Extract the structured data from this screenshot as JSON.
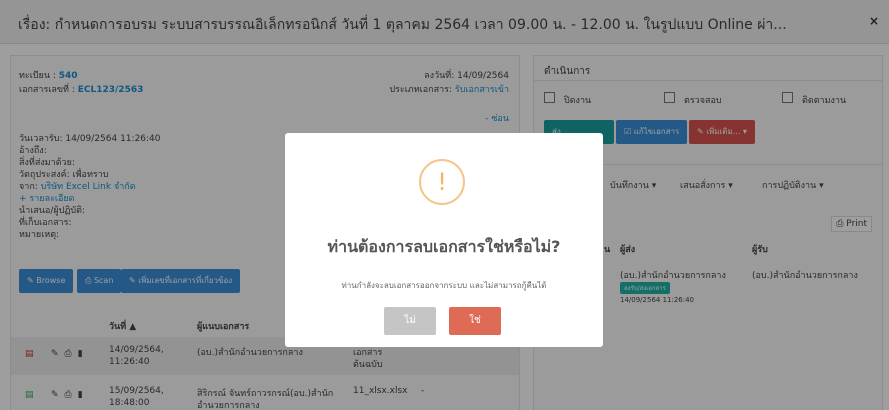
{
  "header": {
    "title": "เรื่อง: กำหนดการอบรม ระบบสารบรรณอิเล็กทรอนิกส์ วันที่ 1 ตุลาคม 2564 เวลา 09.00 น. - 12.00 น. ในรูปแบบ Online ผ่า...",
    "close_icon": "×"
  },
  "doc": {
    "reg_label": "ทะเบียน : ",
    "reg_value": "540",
    "docno_label": "เอกสารเลขที่ : ",
    "docno_value": "ECL123/2563",
    "date_line": "ลงวันที่: 14/09/2564",
    "type_label": "ประเภทเอกสาร: ",
    "type_value": "รับเอกสารเข้า",
    "hide_link": "- ซ่อน",
    "received": "วันเวลารับ: 14/09/2564 11:26:40",
    "to": "อ้างถึง:",
    "attachments": "สิ่งที่ส่งมาด้วย:",
    "purpose": "วัตถุประสงค์: เพื่อทราบ",
    "from_label": "จาก: ",
    "from_value": "บริษัท Excel Link จำกัด",
    "details_link": "+ รายละเอียด",
    "present": "นำเสนอ/ผู้ปฏิบัติ:",
    "storage": "ที่เก็บเอกสาร:",
    "note": "หมายเหตุ:"
  },
  "buttons": {
    "browse": "✎ Browse",
    "scan": "⎙ Scan",
    "add_related": "✎ เพิ่มเลขที่เอกสารที่เกี่ยวข้อง"
  },
  "table": {
    "col_date": "วันที่ ▲",
    "col_by": "ผู้แนบเอกสาร",
    "rows": [
      {
        "date": "14/09/2564,",
        "time": "11:26:40",
        "by": "(อบ.)สำนักอำนวยการกลาง",
        "type1": "เอกสาร",
        "type2": "ต้นฉบับ"
      },
      {
        "date": "15/09/2564,",
        "time": "18:48:00",
        "by": "สิริกรณ์ จันทร์ถาวรกรณ์(อบ.)สำนัก",
        "by2": "อำนวยการกลาง",
        "type1": "11_xlsx.xlsx",
        "type2": "-"
      }
    ]
  },
  "actions": {
    "title": "ดำเนินการ",
    "close": "ปิดงาน",
    "check": "ตรวจสอบ",
    "follow": "ติดตามงาน",
    "send": "ส่ง",
    "edit": "☑ แก้ไขเอกสาร",
    "more": "✎ เพิ่มเติม... ▾"
  },
  "tabs": {
    "record": "บันทึกงาน ▾",
    "order": "เสนอสั่งการ ▾",
    "practice": "การปฏิบัติงาน ▾"
  },
  "print": "⎙ Print",
  "history": {
    "col_status": "น",
    "col_sender": "ผู้ส่ง",
    "col_receiver": "ผู้รับ",
    "sender": "(อบ.)สำนักอำนวยการกลาง",
    "badge": "ลงรับ/ส่งเอกสาร",
    "time": "14/09/2564 11:26:40",
    "receiver": "(อบ.)สำนักอำนวยการกลาง"
  },
  "modal": {
    "icon": "!",
    "heading": "ท่านต้องการลบเอกสารใช่หรือไม่?",
    "text": "ท่านกำลังจะลบเอกสารออกจากระบบ และไม่สามารถกู้คืนได้",
    "no": "ไม่",
    "yes": "ใช่"
  }
}
